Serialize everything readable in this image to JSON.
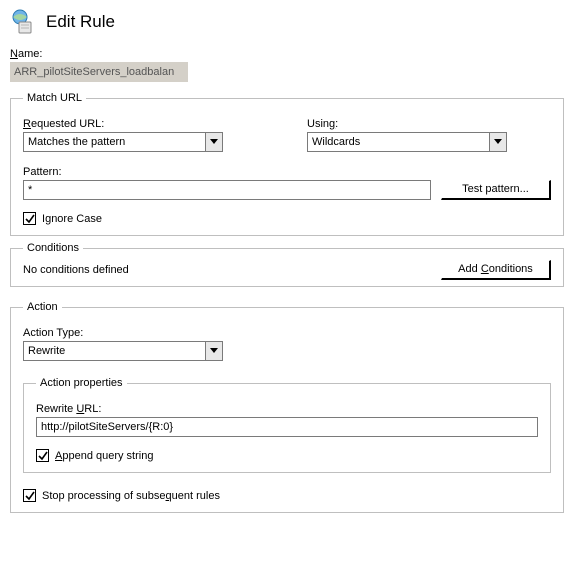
{
  "header": {
    "title": "Edit Rule"
  },
  "name": {
    "label_pre": "N",
    "label_post": "ame:",
    "value": "ARR_pilotSiteServers_loadbalan"
  },
  "match": {
    "legend": "Match URL",
    "requested_label_pre": "R",
    "requested_label_post": "equested URL:",
    "requested_value": "Matches the pattern",
    "using_label_pre": "Usin",
    "using_label_u": "g",
    "using_label_post": ":",
    "using_value": "Wildcards",
    "pattern_label": "Pattern:",
    "pattern_value": "*",
    "test_btn": "Test pattern...",
    "ignore_pre": "I",
    "ignore_u": "g",
    "ignore_post": "nore Case"
  },
  "conditions": {
    "legend": "Conditions",
    "empty_text": "No conditions defined",
    "add_pre": "Add ",
    "add_u": "C",
    "add_post": "onditions"
  },
  "action": {
    "legend": "Action",
    "type_label": "Action Type:",
    "type_value": "Rewrite",
    "props_legend": "Action properties",
    "rewrite_label_pre": "Rewrite ",
    "rewrite_label_u": "U",
    "rewrite_label_post": "RL:",
    "rewrite_value": "http://pilotSiteServers/{R:0}",
    "append_u": "A",
    "append_post": "ppend query string",
    "stop_pre": "Stop processing of subse",
    "stop_u": "q",
    "stop_post": "uent rules"
  }
}
